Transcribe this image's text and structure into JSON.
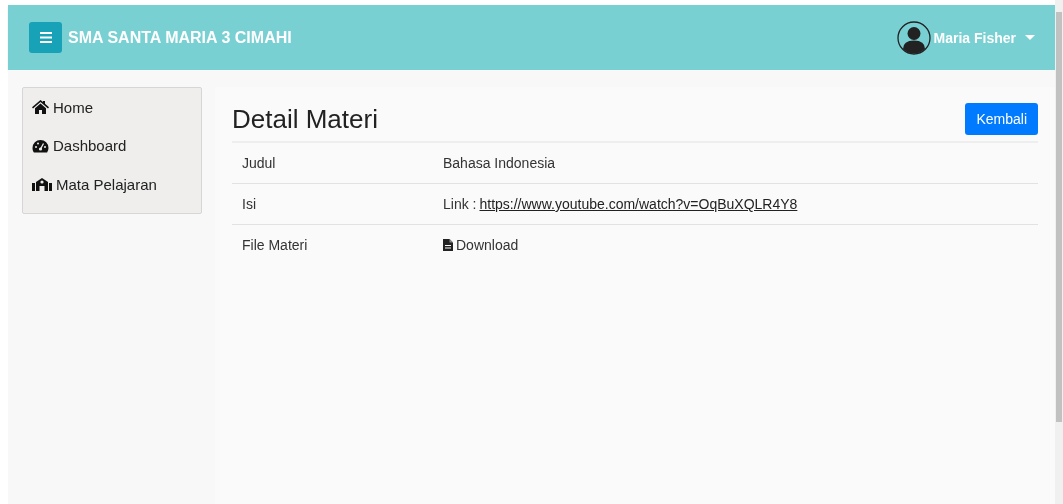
{
  "navbar": {
    "brand": "SMA SANTA MARIA 3 CIMAHI",
    "user": "Maria Fisher"
  },
  "sidebar": {
    "items": [
      {
        "label": "Home"
      },
      {
        "label": "Dashboard"
      },
      {
        "label": "Mata Pelajaran"
      }
    ]
  },
  "main": {
    "title": "Detail Materi",
    "back_button": "Kembali",
    "rows": [
      {
        "label": "Judul",
        "kind": "text",
        "value": "Bahasa Indonesia"
      },
      {
        "label": "Isi",
        "kind": "link",
        "prefix": "Link : ",
        "value": "https://www.youtube.com/watch?v=OqBuXQLR4Y8"
      },
      {
        "label": "File Materi",
        "kind": "download",
        "value": "Download"
      }
    ]
  }
}
